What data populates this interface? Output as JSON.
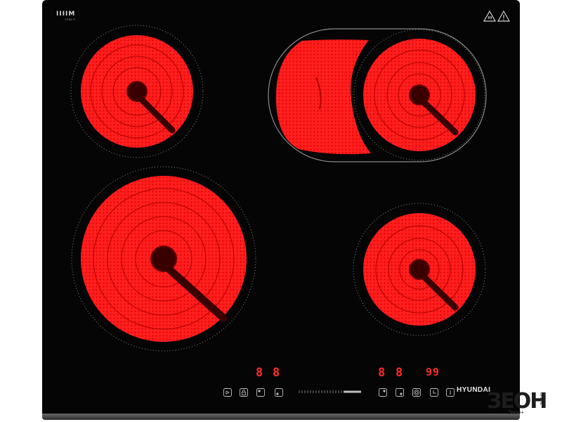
{
  "product": {
    "brand": "HYUNDAI",
    "logo_text": "IIIIM",
    "logo_sub": "ITALY"
  },
  "displays": {
    "left_pair": [
      "8",
      "8"
    ],
    "right_pair": [
      "8",
      "8"
    ],
    "timer": "99"
  },
  "controls": {
    "left": [
      "power-icon",
      "lock-icon",
      "zone-select-icon",
      "zone-select-icon"
    ],
    "right": [
      "zone-select-icon",
      "zone-select-icon",
      "dual-zone-icon",
      "timer-icon",
      "info-icon"
    ]
  },
  "warning_icons": [
    "hot-surface-icon",
    "warning-triangle-icon"
  ],
  "watermark": {
    "logo": "ЗЕОН",
    "tagline": "Зеон+",
    "side_text": "online"
  },
  "colors": {
    "glass": "#050505",
    "heating": "#ff1a1a",
    "display": "#ff2b2b"
  }
}
